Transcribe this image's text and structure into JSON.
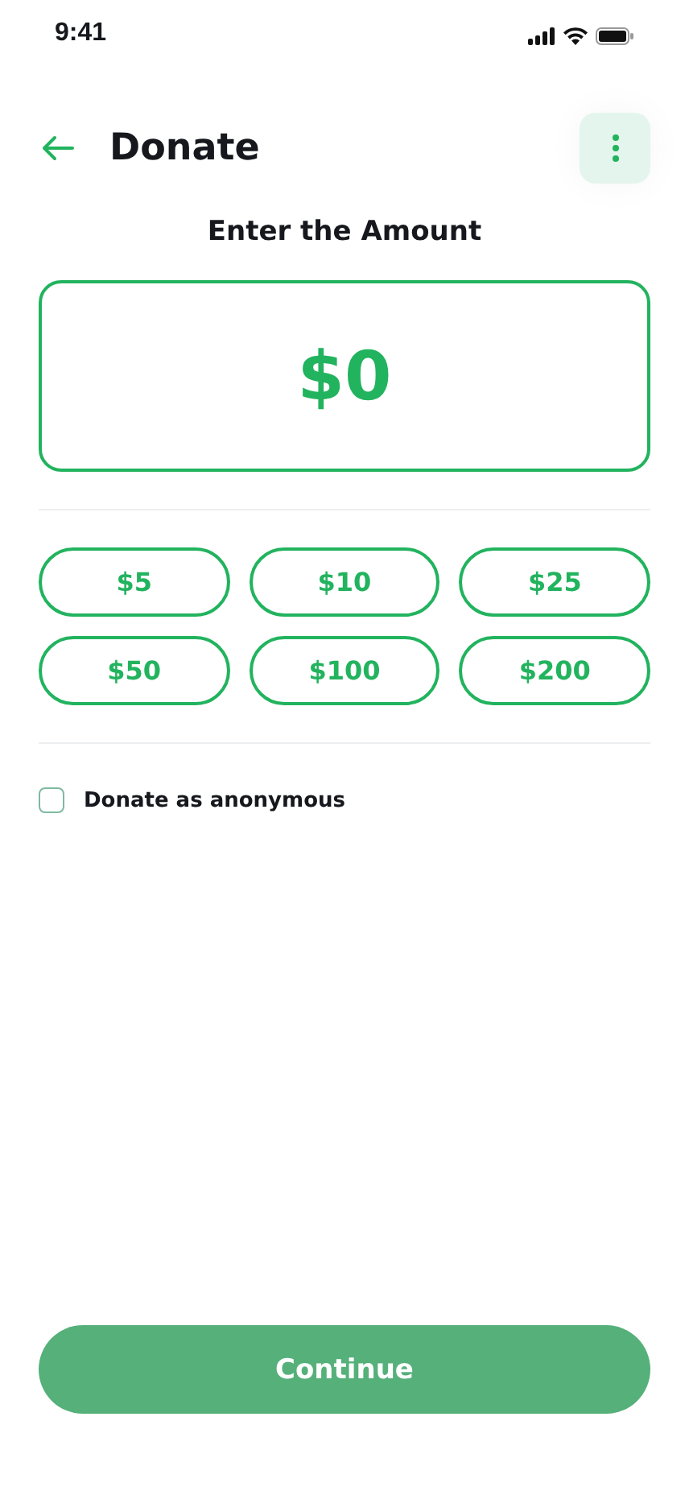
{
  "status_bar": {
    "time": "9:41"
  },
  "header": {
    "title": "Donate"
  },
  "amount": {
    "label": "Enter the Amount",
    "value": "$0"
  },
  "presets": [
    {
      "label": "$5",
      "selected": false
    },
    {
      "label": "$10",
      "selected": false
    },
    {
      "label": "$25",
      "selected": false
    },
    {
      "label": "$50",
      "selected": false
    },
    {
      "label": "$100",
      "selected": false
    },
    {
      "label": "$200",
      "selected": false
    }
  ],
  "anonymous": {
    "label": "Donate as anonymous",
    "checked": false
  },
  "continue_button": {
    "label": "Continue"
  }
}
